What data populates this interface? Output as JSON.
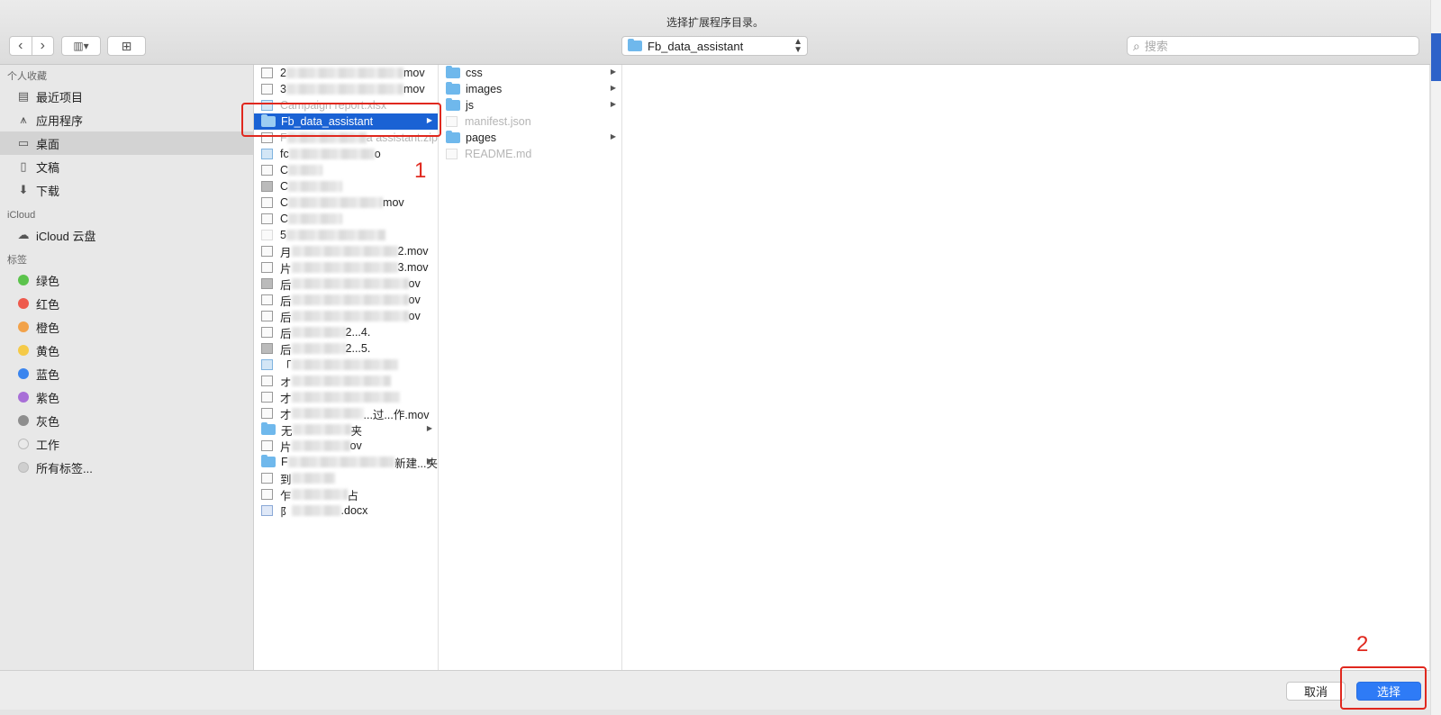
{
  "window": {
    "title": "选择扩展程序目录。"
  },
  "toolbar": {
    "back_icon": "‹",
    "forward_icon": "›",
    "view_icon": "▥▾",
    "newfolder_icon": "⊞",
    "path": "Fb_data_assistant",
    "path_arrows_up": "▲",
    "path_arrows_down": "▼",
    "search_placeholder": "搜索",
    "search_icon": "⌕"
  },
  "sidebar": {
    "favorites_header": "个人收藏",
    "favorites": [
      {
        "label": "最近项目",
        "icon": "▤"
      },
      {
        "label": "应用程序",
        "icon": "⩚"
      },
      {
        "label": "桌面",
        "icon": "▭"
      },
      {
        "label": "文稿",
        "icon": "▯"
      },
      {
        "label": "下载",
        "icon": "⬇"
      }
    ],
    "icloud_header": "iCloud",
    "icloud": [
      {
        "label": "iCloud 云盘",
        "icon": "☁"
      }
    ],
    "tags_header": "标签",
    "tags": [
      {
        "label": "绿色",
        "color": "#5bc34c"
      },
      {
        "label": "红色",
        "color": "#ee5a4d"
      },
      {
        "label": "橙色",
        "color": "#f2a24a"
      },
      {
        "label": "黄色",
        "color": "#f5ca48"
      },
      {
        "label": "蓝色",
        "color": "#3b85ee"
      },
      {
        "label": "紫色",
        "color": "#a86fd7"
      },
      {
        "label": "灰色",
        "color": "#8e8e8e"
      },
      {
        "label": "工作",
        "color": "#e9e9e9"
      },
      {
        "label": "所有标签...",
        "color": "#cfcfcf"
      }
    ]
  },
  "column1": {
    "rows": [
      {
        "prefix": "2",
        "suffix": "mov"
      },
      {
        "prefix": "3",
        "suffix": "mov"
      },
      {
        "prefix": "Campaign report.xlsx",
        "suffix": ""
      },
      {
        "prefix": "Fb_data_assistant",
        "suffix": ""
      },
      {
        "prefix": "F",
        "suffix": "a assistant.zip"
      },
      {
        "prefix": "fc",
        "suffix": "o"
      },
      {
        "prefix": "C",
        "suffix": ""
      },
      {
        "prefix": "C",
        "suffix": ""
      },
      {
        "prefix": "C",
        "suffix": "mov"
      },
      {
        "prefix": "C",
        "suffix": ""
      },
      {
        "prefix": "5",
        "suffix": ""
      },
      {
        "prefix": "月",
        "suffix": "2.mov"
      },
      {
        "prefix": "片",
        "suffix": "3.mov"
      },
      {
        "prefix": "后",
        "suffix": "ov"
      },
      {
        "prefix": "后",
        "suffix": "ov"
      },
      {
        "prefix": "后",
        "suffix": "ov"
      },
      {
        "prefix": "后",
        "suffix": "2...4."
      },
      {
        "prefix": "后",
        "suffix": "2...5."
      },
      {
        "prefix": "「",
        "suffix": ""
      },
      {
        "prefix": "オ",
        "suffix": ""
      },
      {
        "prefix": "才",
        "suffix": ""
      },
      {
        "prefix": "才",
        "suffix": "...过...作.mov"
      },
      {
        "prefix": "无",
        "suffix": "夹"
      },
      {
        "prefix": "片",
        "suffix": "ov"
      },
      {
        "prefix": "F",
        "suffix": "新建...夹"
      },
      {
        "prefix": "到",
        "suffix": ""
      },
      {
        "prefix": "乍",
        "suffix": "占"
      },
      {
        "prefix": "阝",
        "suffix": ".docx"
      }
    ]
  },
  "column2": {
    "rows": [
      {
        "name": "css",
        "kind": "folder"
      },
      {
        "name": "images",
        "kind": "folder"
      },
      {
        "name": "js",
        "kind": "folder"
      },
      {
        "name": "manifest.json",
        "kind": "file"
      },
      {
        "name": "pages",
        "kind": "folder"
      },
      {
        "name": "README.md",
        "kind": "file"
      }
    ]
  },
  "footer": {
    "cancel_label": "取消",
    "select_label": "选择"
  },
  "annotations": {
    "step1": "1",
    "step2": "2"
  }
}
